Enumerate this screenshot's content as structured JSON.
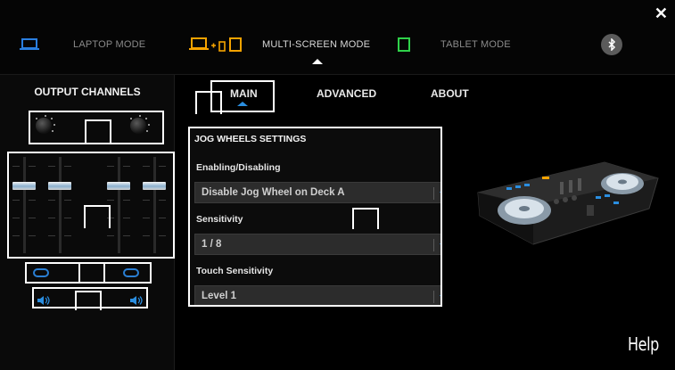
{
  "modes": [
    {
      "label": "LAPTOP MODE",
      "icon": "laptop-icon"
    },
    {
      "label": "MULTI-SCREEN MODE",
      "icon": "multi-screen-icon",
      "active": true
    },
    {
      "label": "TABLET MODE",
      "icon": "tablet-icon"
    }
  ],
  "bluetooth_icon": "bluetooth-icon",
  "close_icon": "close-icon",
  "left_panel": {
    "title": "OUTPUT CHANNELS"
  },
  "tabs": [
    {
      "label": "MAIN",
      "active": true
    },
    {
      "label": "ADVANCED"
    },
    {
      "label": "ABOUT"
    }
  ],
  "jog_settings": {
    "title": "JOG WHEELS SETTINGS",
    "enabling_label": "Enabling/Disabling",
    "enabling_value": "Disable Jog Wheel on Deck A",
    "sensitivity_label": "Sensitivity",
    "sensitivity_value": "1 / 8",
    "touch_label": "Touch Sensitivity",
    "touch_value": "Level 1"
  },
  "help_label": "Help",
  "colors": {
    "accent_blue": "#2a8ee0",
    "tablet_green": "#2fd24a",
    "multiscreen_orange": "#f5a300"
  }
}
